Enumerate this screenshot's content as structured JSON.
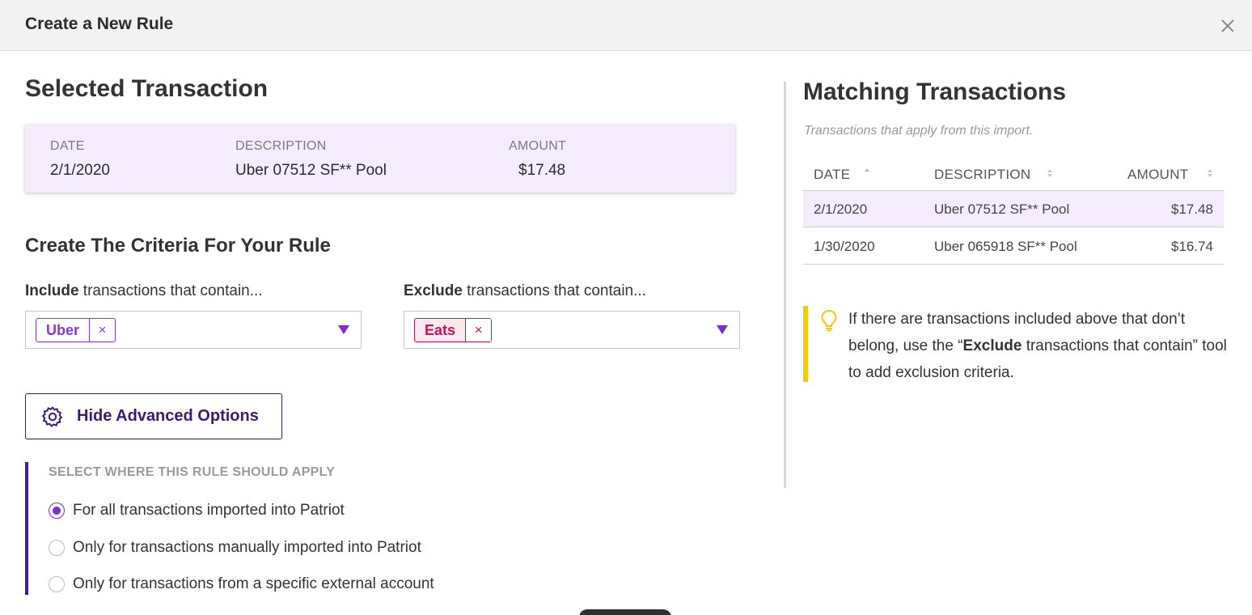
{
  "dialog": {
    "title": "Create a New Rule"
  },
  "selected": {
    "heading": "Selected Transaction",
    "columns": {
      "date": "DATE",
      "description": "DESCRIPTION",
      "amount": "AMOUNT"
    },
    "row": {
      "date": "2/1/2020",
      "description": "Uber 07512 SF** Pool",
      "amount": "$17.48"
    }
  },
  "criteria": {
    "heading": "Create The Criteria For Your Rule",
    "include": {
      "label_bold": "Include",
      "label_rest": " transactions that contain...",
      "tags": [
        "Uber"
      ],
      "remove_symbol": "×"
    },
    "exclude": {
      "label_bold": "Exclude",
      "label_rest": " transactions that contain...",
      "tags": [
        "Eats"
      ],
      "remove_symbol": "×"
    }
  },
  "advanced": {
    "button_label": "Hide Advanced Options",
    "apply_heading": "SELECT WHERE THIS RULE SHOULD APPLY",
    "options": [
      {
        "label": "For all transactions imported into Patriot",
        "checked": true
      },
      {
        "label": "Only for transactions manually imported into Patriot",
        "checked": false
      },
      {
        "label": "Only for transactions from a specific external account",
        "checked": false
      }
    ]
  },
  "matching": {
    "heading": "Matching Transactions",
    "subtitle": "Transactions that apply from this import.",
    "columns": {
      "date": "DATE",
      "description": "DESCRIPTION",
      "amount": "AMOUNT"
    },
    "rows": [
      {
        "date": "2/1/2020",
        "description": "Uber 07512 SF** Pool",
        "amount": "$17.48",
        "highlighted": true
      },
      {
        "date": "1/30/2020",
        "description": "Uber 065918 SF** Pool",
        "amount": "$16.74",
        "highlighted": false
      }
    ]
  },
  "tip": {
    "text_before": "If there are transactions included above that don’t belong, use the “",
    "text_bold": "Exclude",
    "text_after": " transactions that contain” tool to add exclusion criteria."
  },
  "colors": {
    "accent_purple": "#7b2fd3",
    "dark_purple": "#3d1a78",
    "exclude_red": "#c2185b",
    "highlight": "#f4ecfd",
    "tip_yellow": "#f5cc00"
  }
}
